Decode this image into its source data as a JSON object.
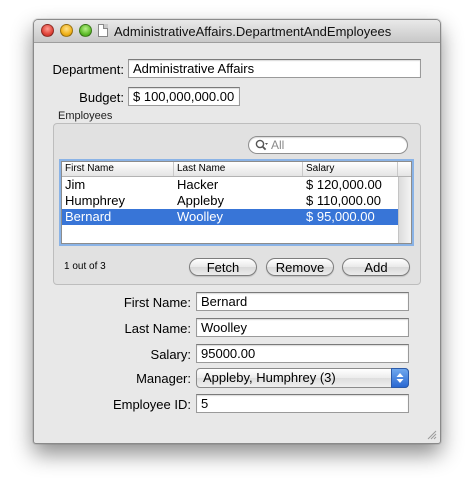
{
  "window": {
    "title": "AdministrativeAffairs.DepartmentAndEmployees"
  },
  "department": {
    "label": "Department:",
    "value": "Administrative Affairs"
  },
  "budget": {
    "label": "Budget:",
    "value": "$ 100,000,000.00"
  },
  "employees_group": {
    "title": "Employees",
    "search_placeholder": "All",
    "columns": [
      "First Name",
      "Last Name",
      "Salary"
    ],
    "rows": [
      {
        "first": "Jim",
        "last": "Hacker",
        "salary": "$ 120,000.00",
        "selected": false
      },
      {
        "first": "Humphrey",
        "last": "Appleby",
        "salary": "$ 110,000.00",
        "selected": false
      },
      {
        "first": "Bernard",
        "last": "Woolley",
        "salary": "$ 95,000.00",
        "selected": true
      }
    ]
  },
  "status": {
    "count_text": "1 out of 3"
  },
  "buttons": {
    "fetch": "Fetch",
    "remove": "Remove",
    "add": "Add"
  },
  "detail": {
    "first_name_label": "First Name:",
    "first_name_value": "Bernard",
    "last_name_label": "Last Name:",
    "last_name_value": "Woolley",
    "salary_label": "Salary:",
    "salary_value": "95000.00",
    "manager_label": "Manager:",
    "manager_value": "Appleby, Humphrey (3)",
    "employee_id_label": "Employee ID:",
    "employee_id_value": "5"
  },
  "colors": {
    "selection": "#3875d7",
    "focus_ring": "#8ab3e6",
    "window_bg": "#e8e8e8"
  },
  "icons": {
    "close": "close-button-red",
    "minimize": "minimize-button-yellow",
    "zoom": "zoom-button-green",
    "document": "document-icon",
    "search": "magnifier-icon",
    "popup": "up-down-arrows-icon",
    "resize": "resize-grip-icon"
  }
}
